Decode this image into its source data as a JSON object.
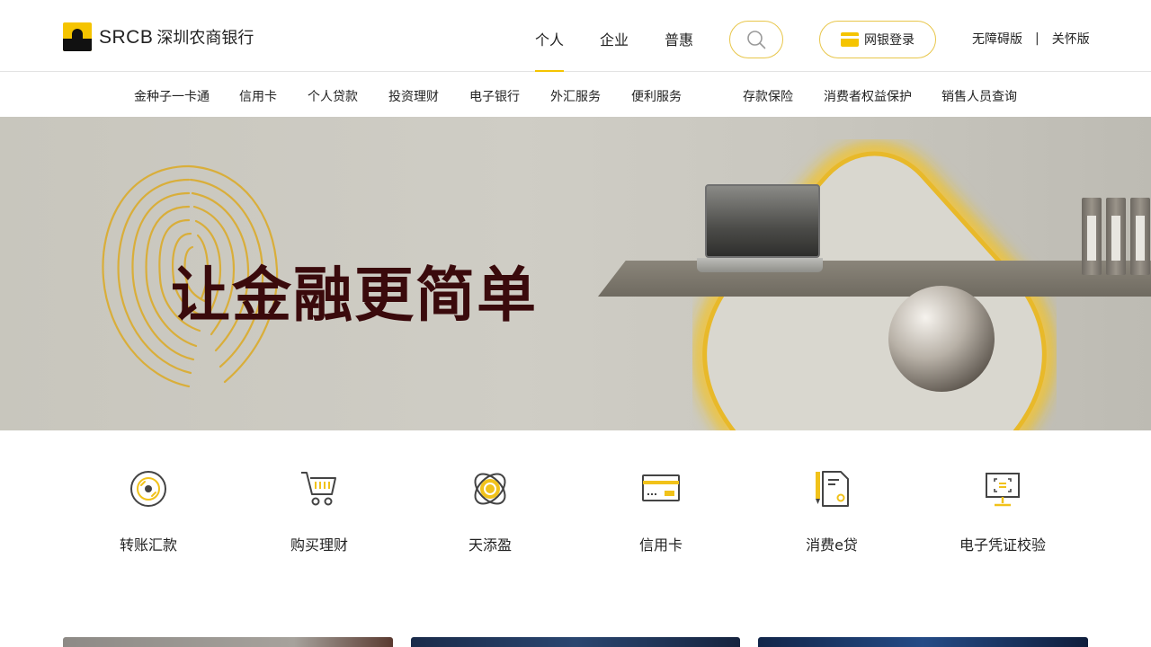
{
  "brand": {
    "name": "SRCB",
    "cn_name": "深圳农商银行",
    "colors": {
      "accent": "#f5c400",
      "dark": "#111111",
      "banner_text": "#3a0a0c"
    }
  },
  "header": {
    "main_nav": [
      {
        "label": "个人",
        "active": true
      },
      {
        "label": "企业",
        "active": false
      },
      {
        "label": "普惠",
        "active": false
      }
    ],
    "search_icon": "search-icon",
    "login_label": "网银登录",
    "links": [
      "无障碍版",
      "关怀版"
    ],
    "link_separator": "|"
  },
  "sub_nav": [
    "金种子一卡通",
    "信用卡",
    "个人贷款",
    "投资理财",
    "电子银行",
    "外汇服务",
    "便利服务",
    "存款保险",
    "消费者权益保护",
    "销售人员查询"
  ],
  "banner": {
    "headline": "让金融更简单"
  },
  "services": [
    {
      "label": "转账汇款",
      "icon": "transfer-icon"
    },
    {
      "label": "购买理财",
      "icon": "cart-icon"
    },
    {
      "label": "天添盈",
      "icon": "coin-orbit-icon"
    },
    {
      "label": "信用卡",
      "icon": "credit-card-icon"
    },
    {
      "label": "消费e贷",
      "icon": "loan-document-icon"
    },
    {
      "label": "电子凭证校验",
      "icon": "screen-verify-icon"
    }
  ]
}
